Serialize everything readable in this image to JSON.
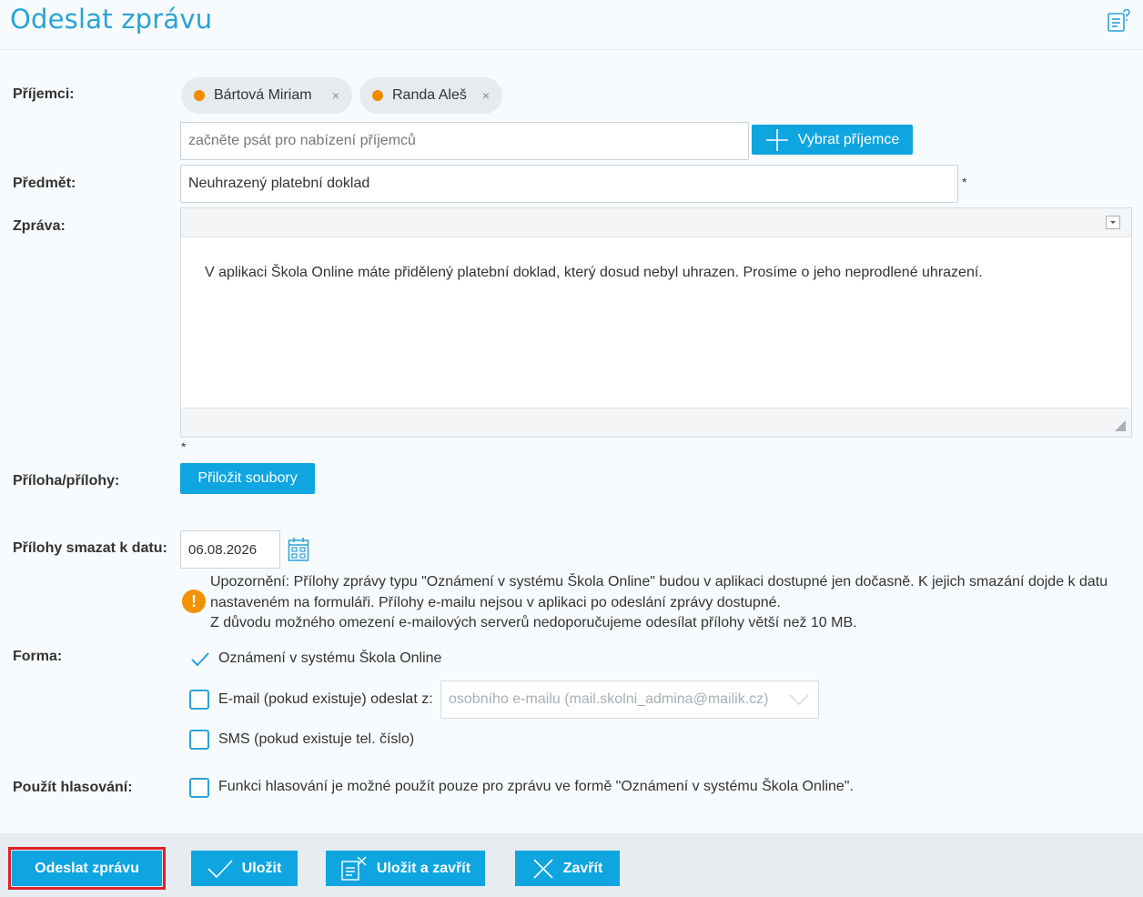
{
  "header": {
    "title": "Odeslat zprávu",
    "help_icon": "help-list-icon"
  },
  "recipients": {
    "label": "Příjemci:",
    "chips": [
      {
        "name": "Bártová Miriam",
        "remove": "×"
      },
      {
        "name": "Randa Aleš",
        "remove": "×"
      }
    ],
    "search_placeholder": "začněte psát pro nabízení příjemců",
    "select_button": "Vybrat příjemce"
  },
  "subject": {
    "label": "Předmět:",
    "value": "Neuhrazený platební doklad",
    "required": "*"
  },
  "message": {
    "label": "Zpráva:",
    "body": "V aplikaci Škola Online máte přidělený platební doklad, který dosud nebyl uhrazen. Prosíme o jeho neprodlené uhrazení.",
    "required": "*"
  },
  "attachments": {
    "label": "Příloha/přílohy:",
    "attach_button": "Přiložit soubory"
  },
  "delete_date": {
    "label": "Přílohy smazat k datu:",
    "value": "06.08.2026"
  },
  "warning": {
    "icon": "!",
    "line1": "Upozornění: Přílohy zprávy typu \"Oznámení v systému Škola Online\" budou v aplikaci dostupné jen dočasně. K jejich smazání dojde k datu nastaveném na formuláři. Přílohy e-mailu nejsou v aplikaci po odeslání zprávy dostupné.",
    "line2": "Z důvodu možného omezení e-mailových serverů nedoporučujeme odesílat přílohy větší než 10 MB."
  },
  "form": {
    "label": "Forma:",
    "options": {
      "system": "Oznámení v systému Škola Online",
      "email": "E-mail (pokud existuje) odeslat z:",
      "email_from": "osobního e-mailu (mail.skolni_admina@mailik.cz)",
      "sms": "SMS (pokud existuje tel. číslo)"
    }
  },
  "voting": {
    "label": "Použít hlasování:",
    "text": "Funkci hlasování je možné použít pouze pro zprávu ve formě \"Oznámení v systému Škola Online\"."
  },
  "footer": {
    "send": "Odeslat zprávu",
    "save": "Uložit",
    "save_close": "Uložit a zavřít",
    "close": "Zavřít"
  },
  "colors": {
    "accent": "#0ea5e0",
    "title": "#29a3d6",
    "warning": "#f39200",
    "chip_dot": "#f08a00",
    "highlight_frame": "#e0202a"
  }
}
